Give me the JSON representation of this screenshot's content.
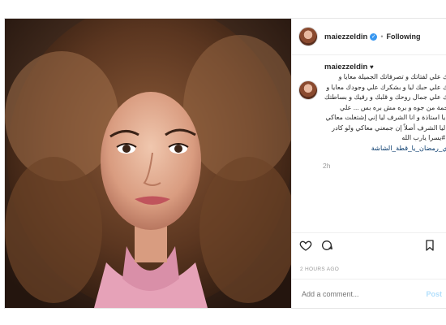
{
  "post": {
    "username": "maiezzeldin",
    "follow_status": "Following",
    "separator": "•",
    "caption_lines": [
      "بشكرك علي لفتاتك و تصرفاتك الجميلة معايا و",
      "بشكرك علي حبك ليا و بشكرك علي وجودك معايا و",
      "بشكرك علي جمال روحك و قلبك و رقيك و بساطتك",
      "انتي نجمة من جوه و بره مش بره بس ... علي",
      "راسي يا استاذة و انا الشرف ليا إني إشتغلت معاكي",
      "مرتين ليا الشرف أصلاً إن جمعني معاكي ولو كادر",
      "واحد . #يسرا يارب الله"
    ],
    "hashtags": "#هتوري_رمضان_يا_قطة_الشاشة",
    "relative_time": "2h",
    "timestamp": "2 HOURS AGO",
    "comment_placeholder": "Add a comment...",
    "post_button": "Post"
  },
  "icons": {
    "like": "heart-icon",
    "comment": "comment-icon",
    "save": "bookmark-icon",
    "verified": "verified-badge-icon"
  },
  "colors": {
    "verified": "#3897f0",
    "hashtag": "#003569",
    "muted": "#999999",
    "post_button_disabled": "#b2dffc"
  }
}
